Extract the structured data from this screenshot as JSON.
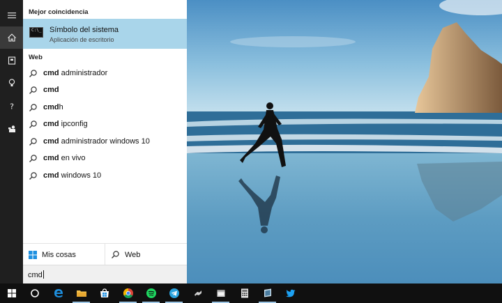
{
  "start_menu": {
    "best_match_header": "Mejor coincidencia",
    "best_match": {
      "title": "Símbolo del sistema",
      "subtitle": "Aplicación de escritorio",
      "icon_glyph": "C:\\_"
    },
    "web_header": "Web",
    "suggestions": [
      {
        "bold": "cmd",
        "rest": " administrador"
      },
      {
        "bold": "cmd",
        "rest": ""
      },
      {
        "bold": "cmd",
        "rest": "h"
      },
      {
        "bold": "cmd",
        "rest": " ipconfig"
      },
      {
        "bold": "cmd",
        "rest": " administrador windows 10"
      },
      {
        "bold": "cmd",
        "rest": " en vivo"
      },
      {
        "bold": "cmd",
        "rest": " windows 10"
      }
    ],
    "tabs": {
      "my_stuff": "Mis cosas",
      "web": "Web"
    },
    "search_value": "cmd"
  },
  "rail_icons": [
    "hamburger-icon",
    "home-icon",
    "notebook-icon",
    "lightbulb-icon",
    "help-icon",
    "feedback-icon"
  ],
  "taskbar_icons": [
    "windows-start-icon",
    "cortana-circle-icon",
    "edge-icon",
    "file-explorer-icon",
    "store-icon",
    "chrome-icon",
    "spotify-icon",
    "telegram-icon",
    "app-icon",
    "app-window-icon",
    "calculator-icon",
    "command-prompt-icon",
    "twitter-icon"
  ],
  "colors": {
    "highlight": "#a9d5ea",
    "rail": "#1f1f1f",
    "taskbar": "#101010",
    "windows_blue": "#1e90e0"
  }
}
